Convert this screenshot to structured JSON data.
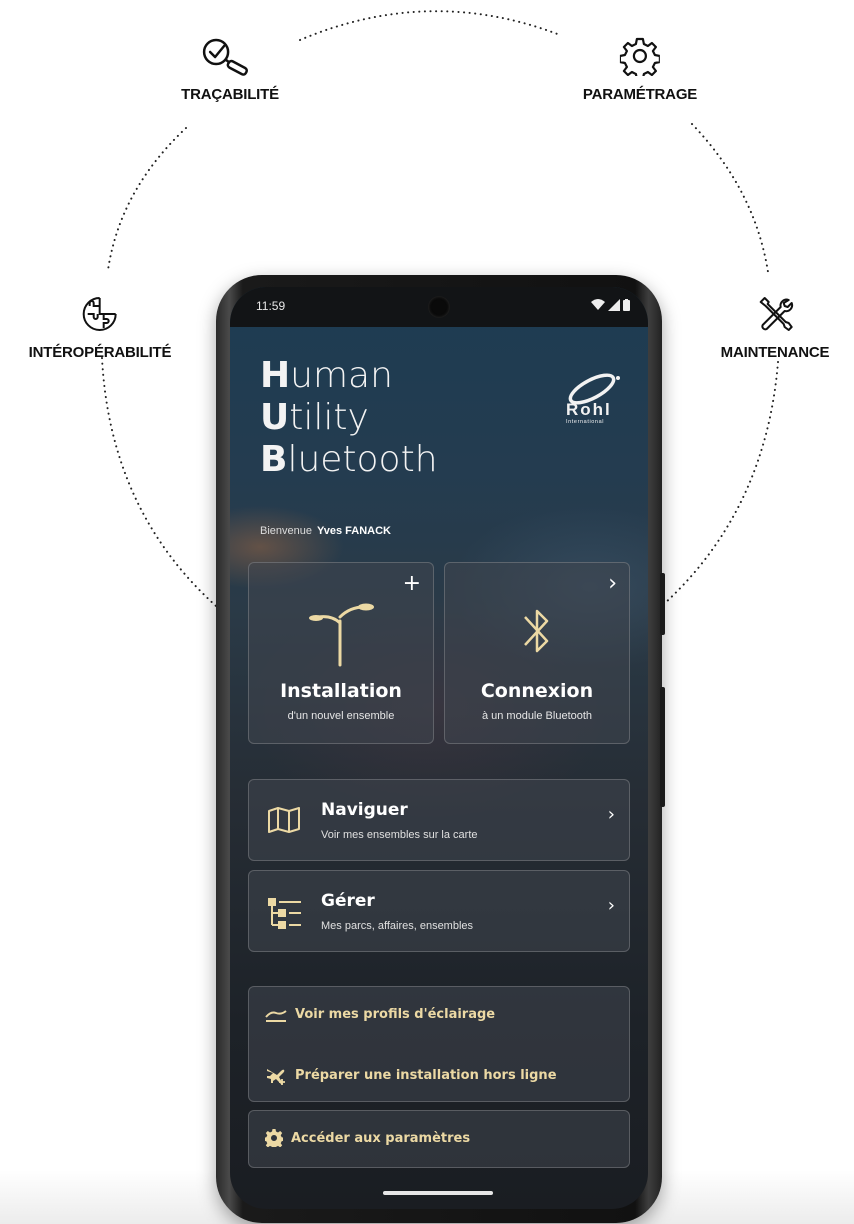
{
  "features": [
    {
      "label": "TRAÇABILITÉ",
      "icon": "check-magnifier-icon"
    },
    {
      "label": "PARAMÉTRAGE",
      "icon": "gear-icon"
    },
    {
      "label": "INTÉROPÉRABILITÉ",
      "icon": "puzzle-globe-icon"
    },
    {
      "label": "MAINTENANCE",
      "icon": "tools-icon"
    }
  ],
  "status_bar": {
    "time": "11:59"
  },
  "app": {
    "title_lines": [
      {
        "initial": "H",
        "rest": "uman"
      },
      {
        "initial": "U",
        "rest": "tility"
      },
      {
        "initial": "B",
        "rest": "luetooth"
      }
    ],
    "welcome_prefix": "Bienvenue",
    "user_name": "Yves FANACK",
    "logo_text": "Rohl",
    "logo_subtext": "International"
  },
  "tiles": [
    {
      "title": "Installation",
      "subtitle": "d'un nouvel ensemble",
      "corner": "+",
      "icon": "street-lamp-icon"
    },
    {
      "title": "Connexion",
      "subtitle": "à un module Bluetooth",
      "corner": "›",
      "icon": "bluetooth-icon"
    }
  ],
  "rows": [
    {
      "title": "Naviguer",
      "subtitle": "Voir mes ensembles sur la carte",
      "icon": "map-icon"
    },
    {
      "title": "Gérer",
      "subtitle": "Mes parcs, affaires, ensembles",
      "icon": "tree-list-icon"
    }
  ],
  "links": {
    "profiles": "Voir mes profils d'éclairage",
    "offline": "Préparer une installation hors ligne",
    "settings": "Accéder aux paramètres"
  },
  "colors": {
    "accent": "#ecd9a4",
    "card_bg": "#3e444c",
    "screen_top": "#1d3c52"
  }
}
